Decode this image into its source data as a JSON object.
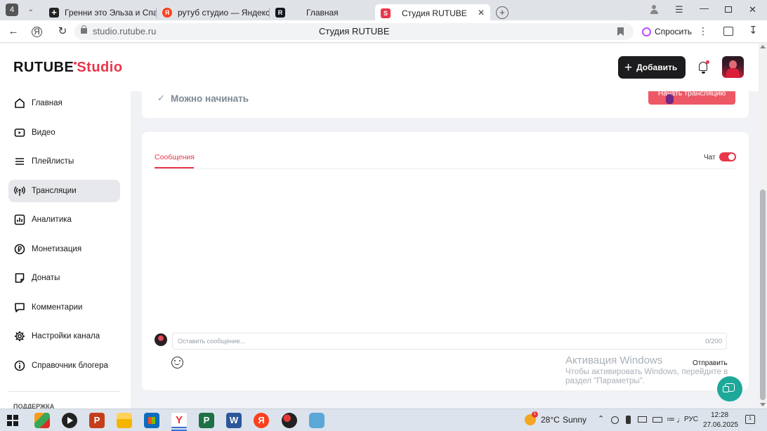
{
  "browser": {
    "tab_count": "4",
    "tabs": [
      {
        "title": "Гренни это Эльза и Спан"
      },
      {
        "title": "рутуб студио — Яндекс: н"
      },
      {
        "title": "Главная"
      },
      {
        "title": "Студия RUTUBE"
      }
    ],
    "url": "studio.rutube.ru",
    "page_title": "Студия RUTUBE",
    "ask_label": "Спросить"
  },
  "header": {
    "logo_main": "RUTUBE",
    "logo_studio": "Studio",
    "add_label": "Добавить"
  },
  "sidebar": {
    "items": [
      {
        "label": "Главная"
      },
      {
        "label": "Видео"
      },
      {
        "label": "Плейлисты"
      },
      {
        "label": "Трансляции"
      },
      {
        "label": "Аналитика"
      },
      {
        "label": "Монетизация"
      },
      {
        "label": "Донаты"
      },
      {
        "label": "Комментарии"
      },
      {
        "label": "Настройки канала"
      },
      {
        "label": "Справочник блогера"
      }
    ],
    "footer_label": "ПОДДЕРЖКА"
  },
  "stream": {
    "status_text": "Можно начинать",
    "start_label": "Начать трансляцию"
  },
  "chat": {
    "tab_label": "Сообщения",
    "toggle_label": "Чат",
    "toggle_on": true,
    "input_placeholder": "Оставить сообщение...",
    "counter": "0/200",
    "send_label": "Отправить"
  },
  "watermark": {
    "title": "Активация Windows",
    "line1": "Чтобы активировать Windows, перейдите в",
    "line2": "раздел \"Параметры\"."
  },
  "taskbar": {
    "weather_temp": "28°C",
    "weather_text": "Sunny",
    "lang": "РУС",
    "time": "12:28",
    "date": "27.06.2025",
    "notif_count": "1"
  },
  "colors": {
    "accent": "#e8364a",
    "dark_button": "#1c1c1e",
    "sidebar_active": "#e6e8eb"
  }
}
